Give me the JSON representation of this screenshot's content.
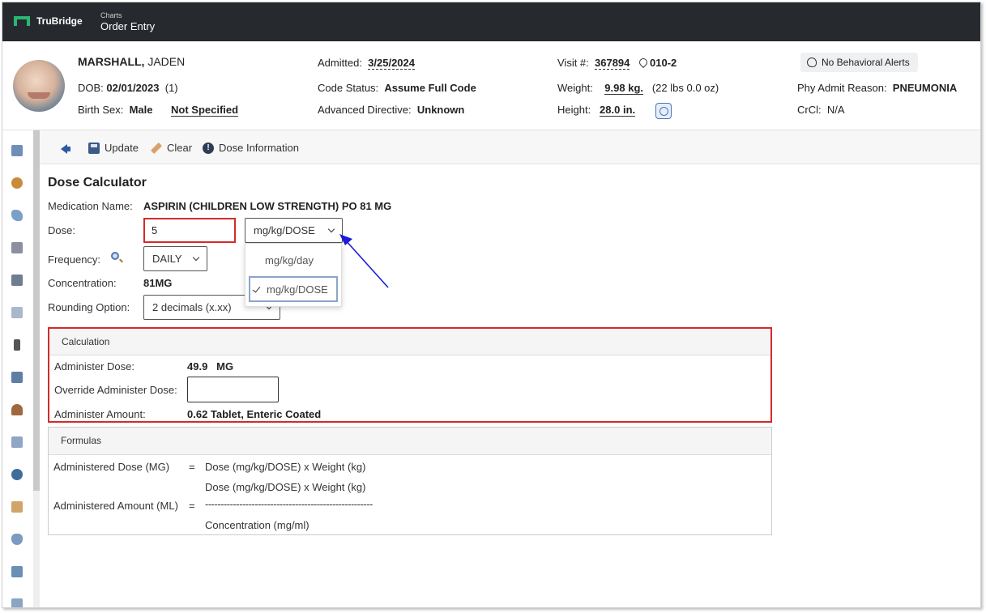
{
  "topbar": {
    "brand": "TruBridge",
    "section": "Charts",
    "title": "Order Entry"
  },
  "patient": {
    "last_name": "MARSHALL,",
    "first_name": "JADEN",
    "dob_label": "DOB:",
    "dob": "02/01/2023",
    "age": "(1)",
    "birth_sex_label": "Birth Sex:",
    "birth_sex": "Male",
    "gender_identity": "Not Specified",
    "admitted_label": "Admitted:",
    "admitted": "3/25/2024",
    "code_status_label": "Code Status:",
    "code_status": "Assume Full Code",
    "adv_directive_label": "Advanced Directive:",
    "adv_directive": "Unknown",
    "visit_label": "Visit #:",
    "visit": "367894",
    "room": "010-2",
    "weight_label": "Weight:",
    "weight": "9.98 kg.",
    "weight_alt": "(22 lbs 0.0 oz)",
    "height_label": "Height:",
    "height": "28.0 in.",
    "behavioral_alerts": "No Behavioral Alerts",
    "admit_reason_label": "Phy Admit Reason:",
    "admit_reason": "PNEUMONIA",
    "crcl_label": "CrCl:",
    "crcl": "N/A"
  },
  "toolbar": {
    "update": "Update",
    "clear": "Clear",
    "dose_info": "Dose Information"
  },
  "dose_calc": {
    "title": "Dose Calculator",
    "med_name_label": "Medication Name:",
    "med_name": "ASPIRIN (CHILDREN LOW STRENGTH) PO 81 MG",
    "dose_label": "Dose:",
    "dose_value": "5",
    "dose_unit": "mg/kg/DOSE",
    "unit_options": [
      "mg/kg/day",
      "mg/kg/DOSE"
    ],
    "frequency_label": "Frequency:",
    "frequency": "DAILY",
    "concentration_label": "Concentration:",
    "concentration": "81MG",
    "rounding_label": "Rounding Option:",
    "rounding": "2 decimals (x.xx)"
  },
  "calculation": {
    "header": "Calculation",
    "admin_dose_label": "Administer Dose:",
    "admin_dose": "49.9",
    "admin_dose_unit": "MG",
    "override_label": "Override Administer Dose:",
    "admin_amount_label": "Administer Amount:",
    "admin_amount": "0.62 Tablet, Enteric Coated"
  },
  "formulas": {
    "header": "Formulas",
    "f1_label": "Administered Dose (MG)",
    "eq": "=",
    "f1_expr": "Dose (mg/kg/DOSE) x Weight (kg)",
    "f2_label": "Administered Amount (ML)",
    "f2_numerator": "Dose (mg/kg/DOSE) x Weight (kg)",
    "f2_divider": "------------------------------------------------------",
    "f2_denominator": "Concentration (mg/ml)"
  }
}
